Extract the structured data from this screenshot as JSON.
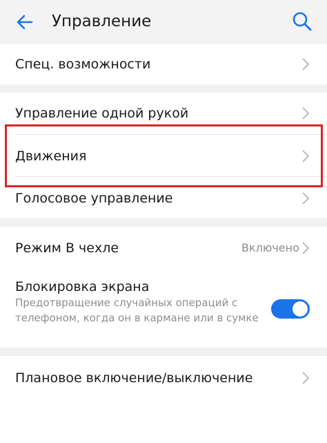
{
  "header": {
    "title": "Управление"
  },
  "items": [
    {
      "label": "Спец. возможности"
    },
    {
      "label": "Управление одной рукой"
    },
    {
      "label": "Движения"
    },
    {
      "label": "Голосовое управление"
    },
    {
      "label": "Режим В чехле",
      "value": "Включено"
    },
    {
      "label": "Блокировка экрана",
      "description": "Предотвращение случайных операций с телефоном, когда он в кармане или в сумке",
      "toggle_on": true
    },
    {
      "label": "Плановое включение/выключение"
    }
  ],
  "colors": {
    "accent": "#1a73e8",
    "highlight": "#e32026"
  }
}
